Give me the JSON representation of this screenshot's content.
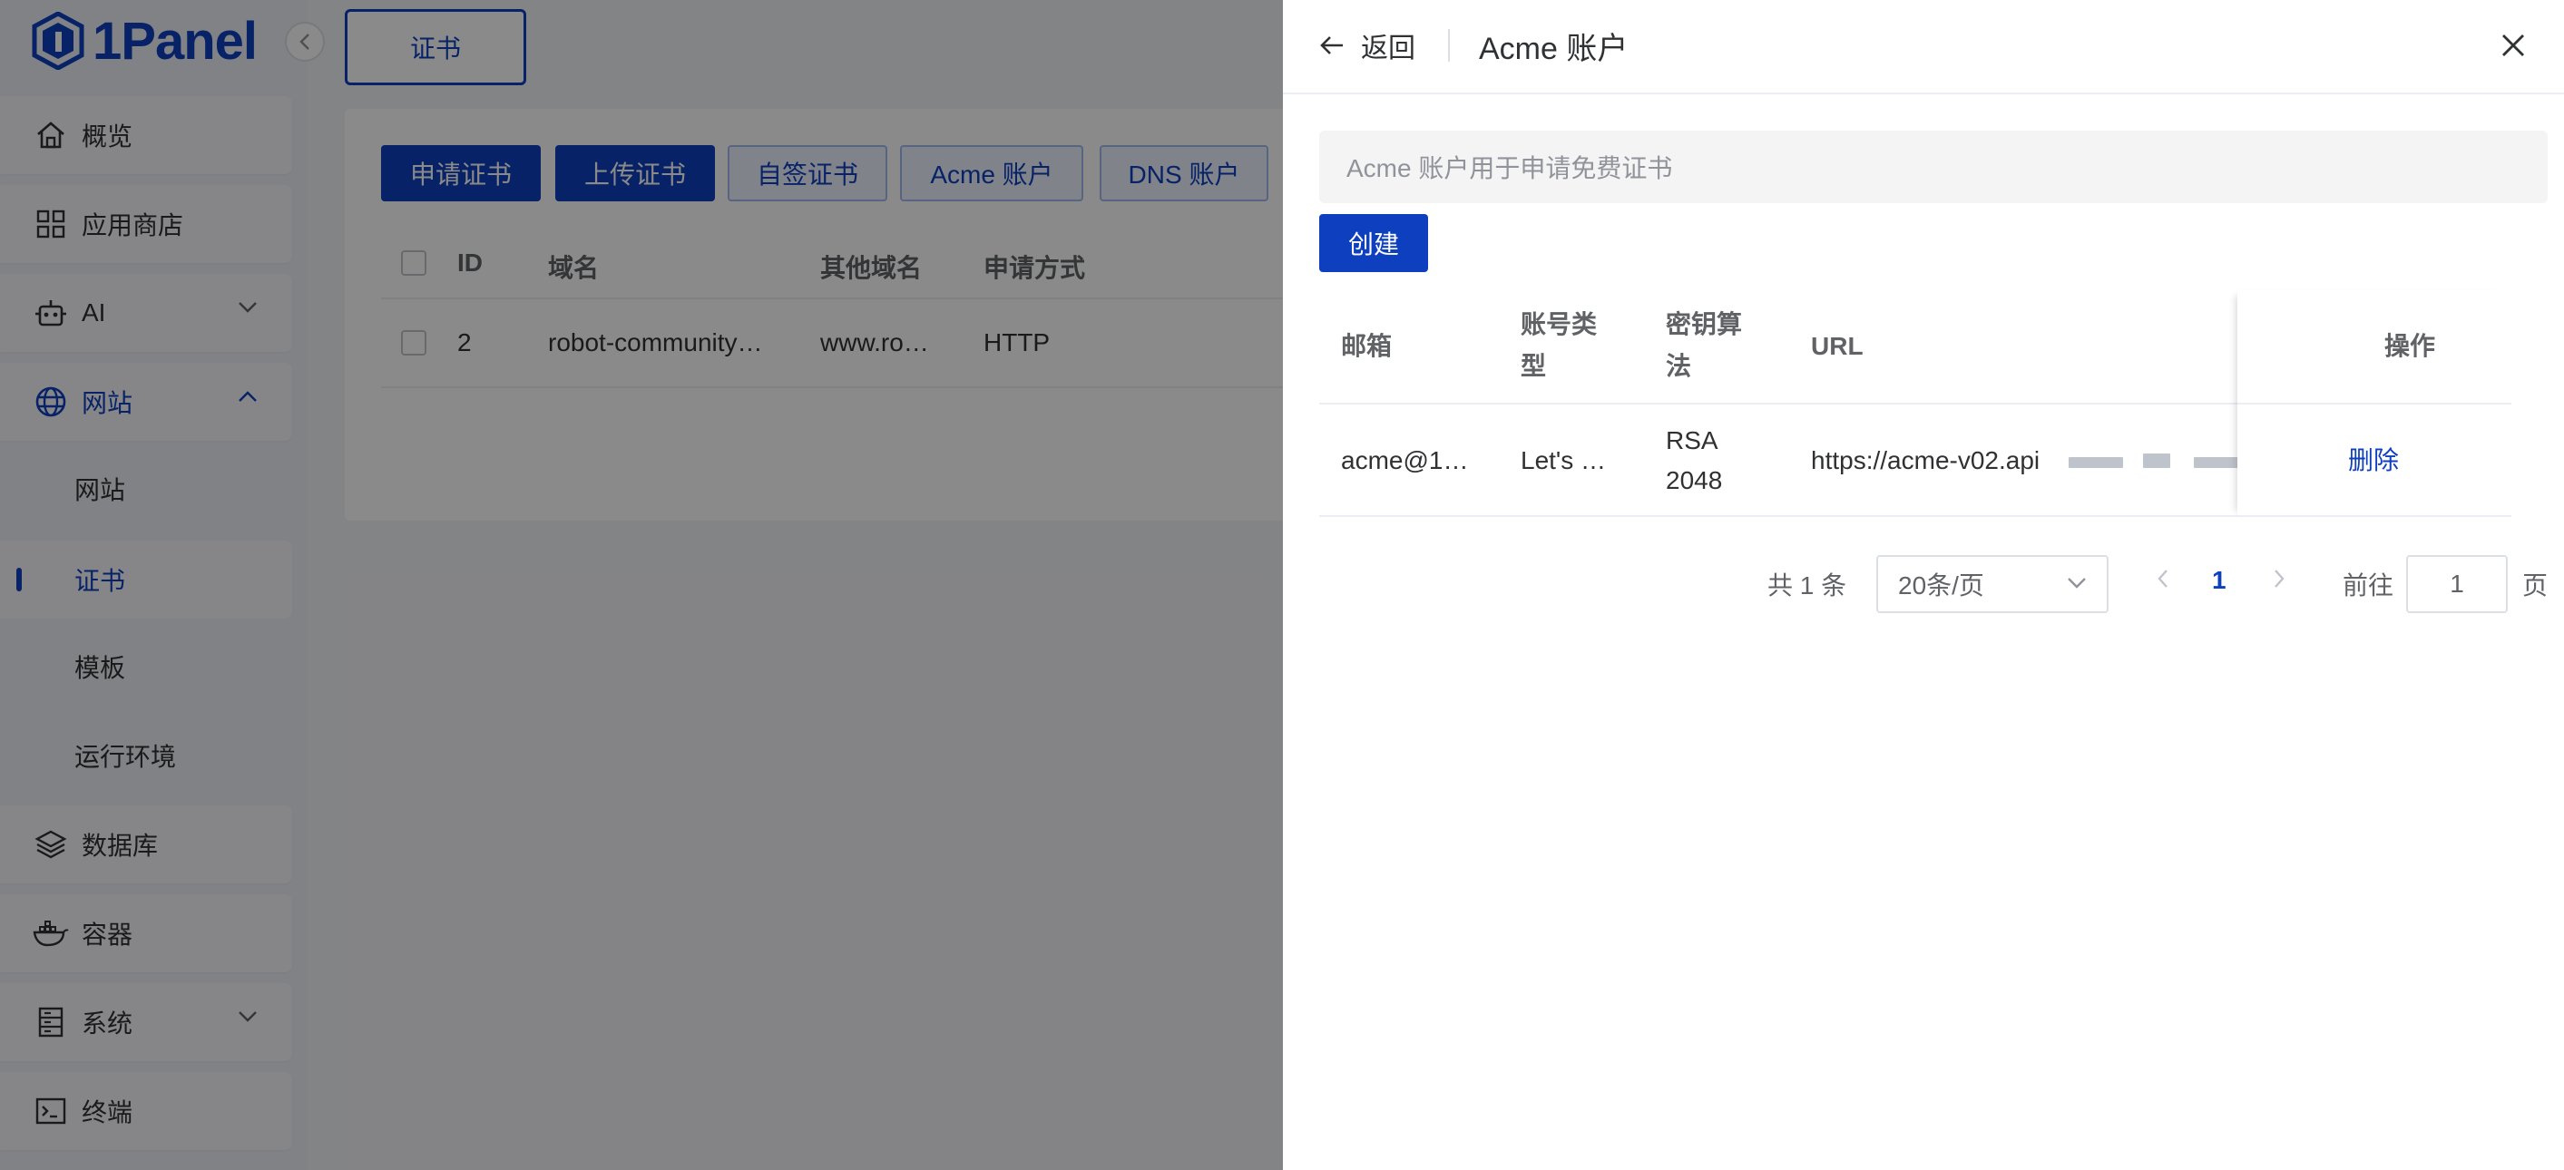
{
  "brand": {
    "logo_text": "1Panel",
    "accent": "#0e3fbf"
  },
  "sidebar": {
    "items": [
      {
        "label": "概览",
        "icon": "home-icon"
      },
      {
        "label": "应用商店",
        "icon": "grid-icon"
      },
      {
        "label": "AI",
        "icon": "robot-icon"
      },
      {
        "label": "网站",
        "icon": "globe-icon"
      },
      {
        "label": "网站"
      },
      {
        "label": "证书"
      },
      {
        "label": "模板"
      },
      {
        "label": "运行环境"
      },
      {
        "label": "数据库",
        "icon": "layers-icon"
      },
      {
        "label": "容器",
        "icon": "docker-icon"
      },
      {
        "label": "系统",
        "icon": "server-icon"
      },
      {
        "label": "终端",
        "icon": "terminal-icon"
      }
    ]
  },
  "tabs": {
    "active": "证书"
  },
  "toolbar": {
    "apply": "申请证书",
    "upload": "上传证书",
    "selfsign": "自签证书",
    "acme": "Acme 账户",
    "dns": "DNS 账户"
  },
  "cert_table": {
    "headers": [
      "ID",
      "域名",
      "其他域名",
      "申请方式"
    ],
    "row": {
      "id": "2",
      "domain": "robot-community…",
      "other": "www.ro…",
      "method": "HTTP"
    }
  },
  "drawer": {
    "back": "返回",
    "title": "Acme 账户",
    "info": "Acme 账户用于申请免费证书",
    "create": "创建",
    "headers": {
      "email": "邮箱",
      "type_1": "账号类",
      "type_2": "型",
      "algo_1": "密钥算",
      "algo_2": "法",
      "url": "URL",
      "ops": "操作"
    },
    "row": {
      "email": "acme@1…",
      "type": "Let's …",
      "algo_1": "RSA",
      "algo_2": "2048",
      "url": "https://acme-v02.api",
      "delete": "删除"
    },
    "pagination": {
      "total": "共 1 条",
      "page_size": "20条/页",
      "current": "1",
      "goto": "前往",
      "goto_value": "1",
      "page_suffix": "页"
    }
  }
}
